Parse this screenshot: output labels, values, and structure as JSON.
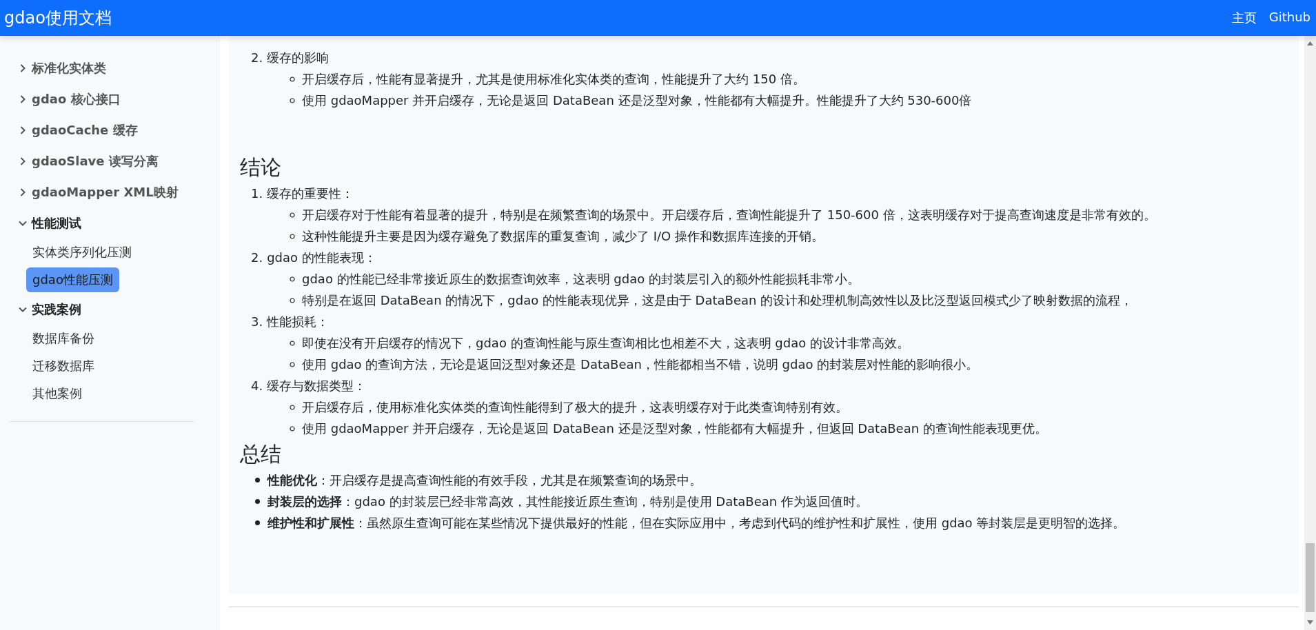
{
  "header": {
    "title": "gdao使用文档",
    "links": [
      "主页",
      "Github"
    ]
  },
  "sidebar": {
    "items": [
      {
        "label": "标准化实体类",
        "kind": "group",
        "expanded": false
      },
      {
        "label": "gdao 核心接口",
        "kind": "group",
        "expanded": false
      },
      {
        "label": "gdaoCache 缓存",
        "kind": "group",
        "expanded": false
      },
      {
        "label": "gdaoSlave 读写分离",
        "kind": "group",
        "expanded": false
      },
      {
        "label": "gdaoMapper XML映射",
        "kind": "group",
        "expanded": false
      },
      {
        "label": "性能测试",
        "kind": "group",
        "expanded": true,
        "children": [
          {
            "label": "实体类序列化压测",
            "selected": false
          },
          {
            "label": "gdao性能压测",
            "selected": true
          }
        ]
      },
      {
        "label": "实践案例",
        "kind": "group",
        "expanded": true,
        "children": [
          {
            "label": "数据库备份",
            "selected": false
          },
          {
            "label": "迁移数据库",
            "selected": false
          },
          {
            "label": "其他案例",
            "selected": false
          }
        ]
      }
    ]
  },
  "content": {
    "blocks": [
      {
        "kind": "ordered",
        "items": [
          {
            "number": "2.",
            "text": "缓存的影响",
            "points": [
              "开启缓存后，性能有显著提升，尤其是使用标准化实体类的查询，性能提升了大约 150 倍。",
              "使用 gdaoMapper 并开启缓存，无论是返回 DataBean 还是泛型对象，性能都有大幅提升。性能提升了大约 530-600倍"
            ]
          }
        ]
      },
      {
        "kind": "heading",
        "text": "结论"
      },
      {
        "kind": "ordered",
        "items": [
          {
            "number": "1.",
            "text": "缓存的重要性：",
            "points": [
              "开启缓存对于性能有着显著的提升，特别是在频繁查询的场景中。开启缓存后，查询性能提升了 150-600 倍，这表明缓存对于提高查询速度是非常有效的。",
              "这种性能提升主要是因为缓存避免了数据库的重复查询，减少了 I/O 操作和数据库连接的开销。"
            ]
          },
          {
            "number": "2.",
            "text": "gdao 的性能表现：",
            "points": [
              "gdao 的性能已经非常接近原生的数据查询效率，这表明 gdao 的封装层引入的额外性能损耗非常小。",
              "特别是在返回 DataBean 的情况下，gdao 的性能表现优异，这是由于 DataBean 的设计和处理机制高效性以及比泛型返回模式少了映射数据的流程，"
            ]
          },
          {
            "number": "3.",
            "text": "性能损耗：",
            "points": [
              "即使在没有开启缓存的情况下，gdao 的查询性能与原生查询相比也相差不大，这表明 gdao 的设计非常高效。",
              "使用 gdao 的查询方法，无论是返回泛型对象还是 DataBean，性能都相当不错，说明 gdao 的封装层对性能的影响很小。"
            ]
          },
          {
            "number": "4.",
            "text": "缓存与数据类型：",
            "points": [
              "开启缓存后，使用标准化实体类的查询性能得到了极大的提升，这表明缓存对于此类查询特别有效。",
              "使用 gdaoMapper 并开启缓存，无论是返回 DataBean 还是泛型对象，性能都有大幅提升，但返回 DataBean 的查询性能表现更优。"
            ]
          }
        ]
      },
      {
        "kind": "heading",
        "text": "总结"
      },
      {
        "kind": "bullets",
        "items": [
          "**性能优化**：开启缓存是提高查询性能的有效手段，尤其是在频繁查询的场景中。",
          "**封装层的选择**：gdao 的封装层已经非常高效，其性能接近原生查询，特别是使用 DataBean 作为返回值时。",
          "**维护性和扩展性**：虽然原生查询可能在某些情况下提供最好的性能，但在实际应用中，考虑到代码的维护性和扩展性，使用 gdao 等封装层是更明智的选择。"
        ]
      }
    ]
  }
}
